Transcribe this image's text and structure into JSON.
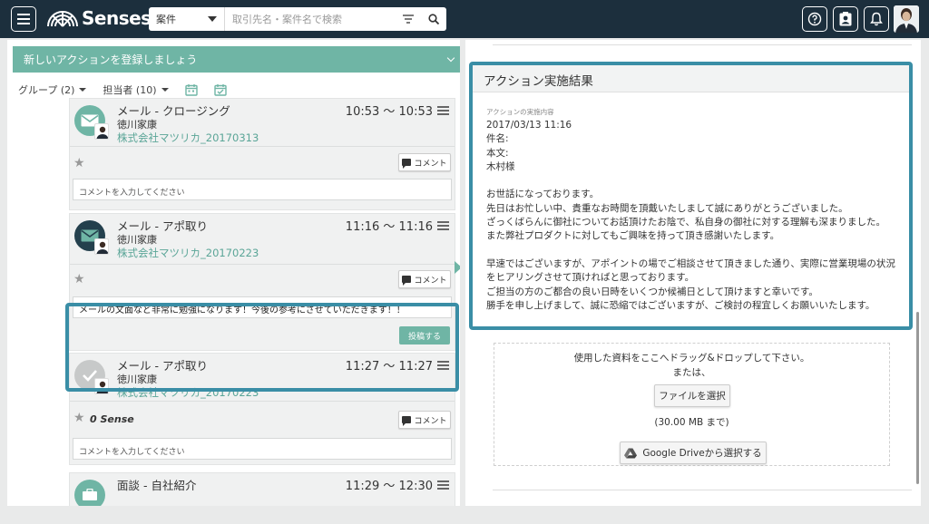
{
  "topbar": {
    "logo_text": "Senses",
    "search": {
      "type": "案件",
      "placeholder": "取引先名・案件名で検索"
    }
  },
  "left": {
    "banner": "新しいアクションを登録しましょう",
    "filters": {
      "group": "グループ (2)",
      "owner": "担当者 (10)"
    },
    "cards": [
      {
        "title": "メール - クロージング",
        "time": "10:53 〜 10:53",
        "person": "徳川家康",
        "link": "株式会社マツリカ_20170313",
        "comment_btn": "コメント",
        "comment_placeholder": "コメントを入力してください"
      },
      {
        "title": "メール - アポ取り",
        "time": "11:16 〜 11:16",
        "person": "徳川家康",
        "link": "株式会社マツリカ_20170223",
        "comment_btn": "コメント",
        "comment_value": "メールの文面など非常に勉強になります！今後の参考にさせていただきます！！",
        "post_btn": "投稿する"
      },
      {
        "title": "メール - アポ取り",
        "time": "11:27 〜 11:27",
        "person": "徳川家康",
        "link": "株式会社マツリカ_20170223",
        "sense": "0 Sense",
        "comment_btn": "コメント",
        "comment_placeholder": "コメントを入力してください"
      },
      {
        "title": "面談 - 自社紹介",
        "time": "11:29 〜 12:30"
      }
    ]
  },
  "right": {
    "result_title": "アクション実施結果",
    "result_label": "アクションの実施内容",
    "result_body": "2017/03/13 11:16\n件名:\n本文:\n木村様\n\nお世話になっております。\n先日はお忙しい中、貴重なお時間を頂戴いたしまして誠にありがとうございました。\nざっくばらんに御社についてお話頂けたお陰で、私自身の御社に対する理解も深まりました。\nまた弊社プロダクトに対してもご興味を持って頂き感謝いたします。\n\n早速ではございますが、アポイントの場でご相談させて頂きました通り、実際に営業現場の状況\nをヒアリングさせて頂ければと思っております。\nご担当の方のご都合の良い日時をいくつか候補日として頂けますと幸いです。\n勝手を申し上げまして、誠に恐縮ではございますが、ご検討の程宜しくお願いいたします。",
    "upload": {
      "drop_text": "使用した資料をここへドラッグ&ドロップして下さい。",
      "or_text": "または、",
      "file_btn": "ファイルを選択",
      "limit": "(30.00 MB まで)",
      "gdrive_btn": "Google Driveから選択する"
    }
  },
  "colors": {
    "topbar": "#1c2f3d",
    "accent": "#6fb5a5",
    "highlight": "#3a8ea6"
  }
}
